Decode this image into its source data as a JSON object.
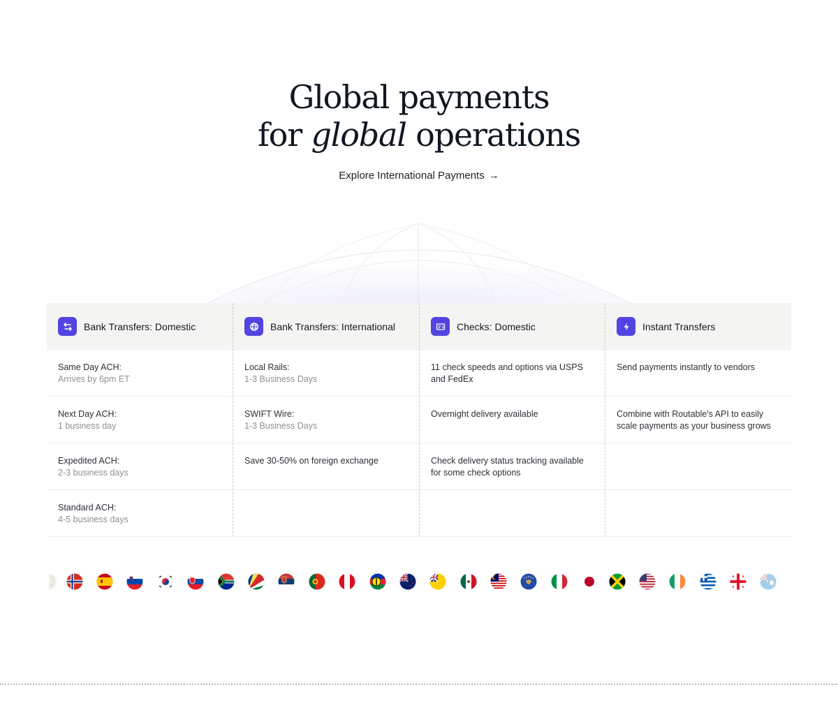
{
  "hero": {
    "title_line1": "Global payments",
    "title_line2_prefix": "for ",
    "title_line2_italic": "global",
    "title_line2_suffix": " operations",
    "link_label": "Explore International Payments",
    "link_arrow": "→"
  },
  "columns": [
    {
      "title": "Bank Transfers: Domestic",
      "icon": "arrows-exchange-icon",
      "rows": [
        {
          "label": "Same Day ACH:",
          "detail": "Arrives by 6pm ET"
        },
        {
          "label": "Next Day ACH:",
          "detail": "1 business day"
        },
        {
          "label": "Expedited ACH:",
          "detail": "2-3 business days"
        },
        {
          "label": "Standard ACH:",
          "detail": "4-5 business days"
        }
      ]
    },
    {
      "title": "Bank Transfers: International",
      "icon": "globe-icon",
      "rows": [
        {
          "label": "Local Rails:",
          "detail": "1-3 Business Days"
        },
        {
          "label": "SWIFT Wire:",
          "detail": "1-3 Business Days"
        },
        {
          "label": "Save 30-50% on foreign exchange",
          "detail": ""
        },
        {
          "label": "",
          "detail": ""
        }
      ]
    },
    {
      "title": "Checks: Domestic",
      "icon": "check-document-icon",
      "rows": [
        {
          "label": "11 check speeds and options via USPS and FedEx",
          "detail": ""
        },
        {
          "label": "Overnight delivery available",
          "detail": ""
        },
        {
          "label": "Check delivery status tracking available for some check options",
          "detail": ""
        },
        {
          "label": "",
          "detail": ""
        }
      ]
    },
    {
      "title": "Instant Transfers",
      "icon": "lightning-bolt-icon",
      "rows": [
        {
          "label": "Send payments instantly to vendors",
          "detail": ""
        },
        {
          "label": "Combine with Routable's API to easily scale payments as your business grows",
          "detail": ""
        },
        {
          "label": "",
          "detail": ""
        },
        {
          "label": "",
          "detail": ""
        }
      ]
    }
  ],
  "colors": {
    "accent": "#5244e0",
    "header_band": "#f4f4f2",
    "title": "#0f1720",
    "muted": "#8d9096"
  },
  "flags": [
    "partial-flag-icon",
    "norway-flag-icon",
    "spain-flag-icon",
    "slovenia-flag-icon",
    "south-korea-flag-icon",
    "slovakia-flag-icon",
    "south-africa-flag-icon",
    "seychelles-flag-icon",
    "serbia-flag-icon",
    "portugal-flag-icon",
    "peru-flag-icon",
    "new-caledonia-flag-icon",
    "new-zealand-flag-icon",
    "niue-flag-icon",
    "mexico-flag-icon",
    "malaysia-flag-icon",
    "kosovo-flag-icon",
    "italy-flag-icon",
    "japan-flag-icon",
    "jamaica-flag-icon",
    "united-states-flag-icon",
    "ireland-flag-icon",
    "greece-flag-icon",
    "georgia-flag-icon",
    "fiji-flag-icon"
  ]
}
